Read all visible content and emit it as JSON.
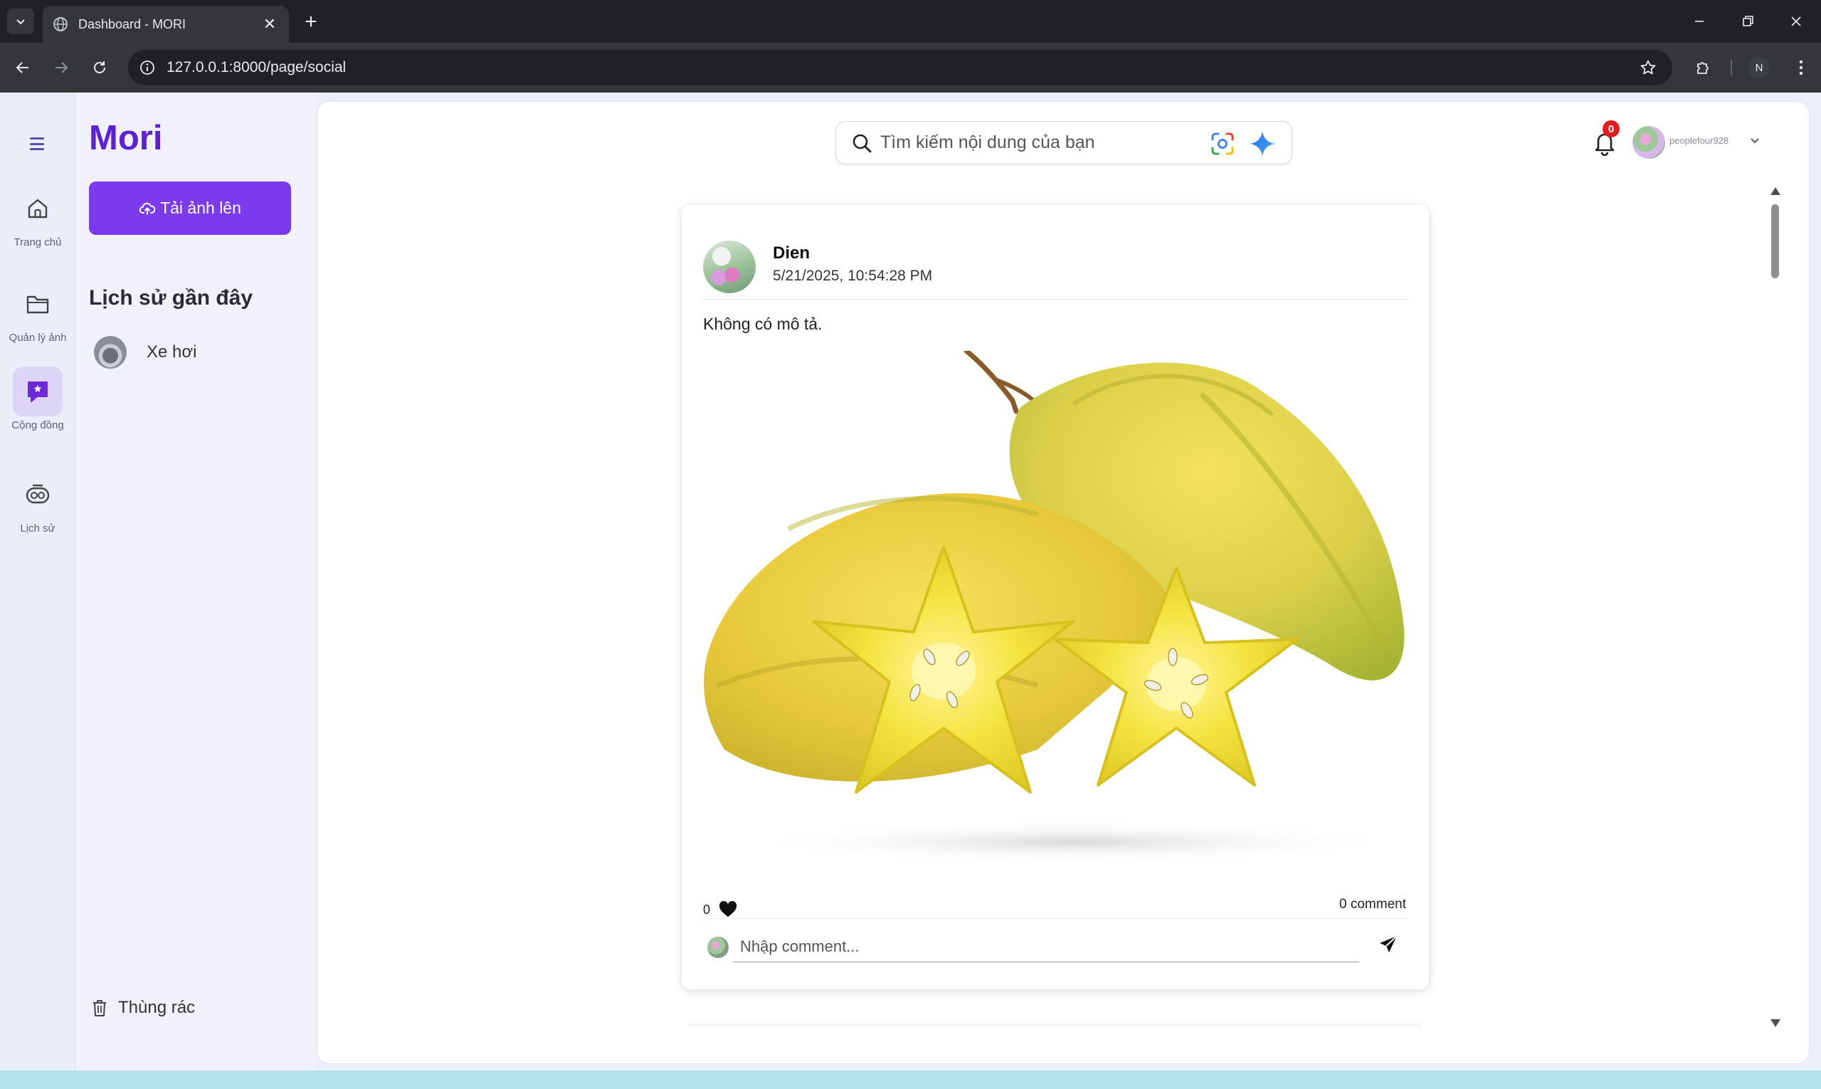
{
  "browser": {
    "tab_title": "Dashboard - MORI",
    "url": "127.0.0.1:8000/page/social",
    "profile_initial": "N"
  },
  "rail": {
    "items": [
      {
        "label": "Trang chủ",
        "icon": "home-icon"
      },
      {
        "label": "Quản lý ảnh",
        "icon": "folder-icon"
      },
      {
        "label": "Cộng đồng",
        "icon": "community-icon",
        "active": true
      },
      {
        "label": "Lịch sử",
        "icon": "history-icon"
      }
    ]
  },
  "sidebar": {
    "brand": "Mori",
    "upload_label": "Tải ảnh lên",
    "history_title": "Lịch sử gần đây",
    "history_items": [
      {
        "label": "Xe hơi"
      }
    ],
    "trash_label": "Thùng rác"
  },
  "header": {
    "search_placeholder": "Tìm kiếm nội dung của bạn",
    "notification_count": "0",
    "username": "peoplefour928"
  },
  "post": {
    "author": "Dien",
    "time": "5/21/2025, 10:54:28 PM",
    "description": "Không có mô tả.",
    "likes": "0",
    "comments": "0 comment",
    "comment_placeholder": "Nhập comment..."
  },
  "colors": {
    "brand": "#5b21d6",
    "accent": "#7c3aed",
    "badge": "#e11d1d"
  }
}
